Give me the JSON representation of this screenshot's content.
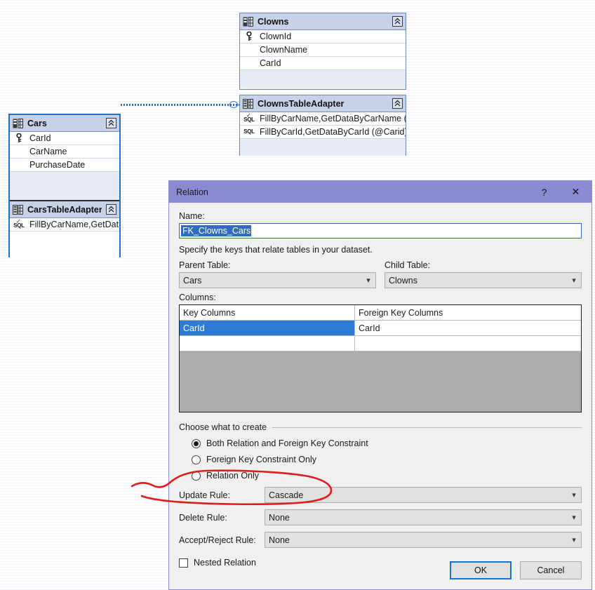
{
  "canvas": {
    "entities": [
      {
        "name": "Clowns",
        "kind": "table",
        "icon": "table-icon",
        "collapse_icon": "collapse-chevrons-icon",
        "fields": [
          {
            "label": "ClownId",
            "gutter_icon": "key-icon"
          },
          {
            "label": "ClownName",
            "gutter_icon": ""
          },
          {
            "label": "CarId",
            "gutter_icon": ""
          }
        ]
      },
      {
        "name": "ClownsTableAdapter",
        "kind": "adapter",
        "icon": "table-adapter-icon",
        "collapse_icon": "collapse-chevrons-icon",
        "fields": [
          {
            "label": "FillByCarName,GetDataByCarName (...",
            "gutter_icon": "sql-default-icon"
          },
          {
            "label": "FillByCarId,GetDataByCarId (@Carid)",
            "gutter_icon": "sql-icon"
          }
        ]
      },
      {
        "name": "Cars",
        "kind": "table",
        "icon": "table-icon",
        "collapse_icon": "collapse-chevrons-icon",
        "fields": [
          {
            "label": "CarId",
            "gutter_icon": "key-icon"
          },
          {
            "label": "CarName",
            "gutter_icon": ""
          },
          {
            "label": "PurchaseDate",
            "gutter_icon": ""
          }
        ]
      },
      {
        "name": "CarsTableAdapter",
        "kind": "adapter",
        "icon": "table-adapter-icon",
        "collapse_icon": "collapse-chevrons-icon",
        "fields": [
          {
            "label": "FillByCarName,GetDat...",
            "gutter_icon": "sql-default-icon"
          }
        ]
      }
    ],
    "relation_connector": "dotted-relation-line"
  },
  "dialog": {
    "title": "Relation",
    "help_label": "?",
    "close_label": "✕",
    "name_label": "Name:",
    "name_value": "FK_Clowns_Cars",
    "description": "Specify the keys that relate tables in your dataset.",
    "parent_table_label": "Parent Table:",
    "parent_table_value": "Cars",
    "child_table_label": "Child Table:",
    "child_table_value": "Clowns",
    "columns_label": "Columns:",
    "grid": {
      "headers": [
        "Key Columns",
        "Foreign Key Columns"
      ],
      "rows": [
        {
          "key": "CarId",
          "foreign": "CarId",
          "selected": true
        },
        {
          "key": "",
          "foreign": "",
          "selected": false
        }
      ]
    },
    "group_title": "Choose what to create",
    "options": [
      {
        "label": "Both Relation and Foreign Key Constraint",
        "checked": true
      },
      {
        "label": "Foreign Key Constraint Only",
        "checked": false
      },
      {
        "label": "Relation Only",
        "checked": false
      }
    ],
    "rules": [
      {
        "label": "Update Rule:",
        "value": "Cascade"
      },
      {
        "label": "Delete Rule:",
        "value": "None"
      },
      {
        "label": "Accept/Reject Rule:",
        "value": "None"
      }
    ],
    "nested_relation_label": "Nested Relation",
    "nested_relation_checked": false,
    "ok_label": "OK",
    "cancel_label": "Cancel",
    "colors": {
      "titlebar": "#8b8bd4",
      "selection": "#2f7bd4",
      "accent_focus": "#1d72c4",
      "annotation": "#e01b1b"
    }
  },
  "annotation": {
    "shape": "red-hand-drawn-ellipse",
    "target": "Update Rule: Cascade"
  }
}
